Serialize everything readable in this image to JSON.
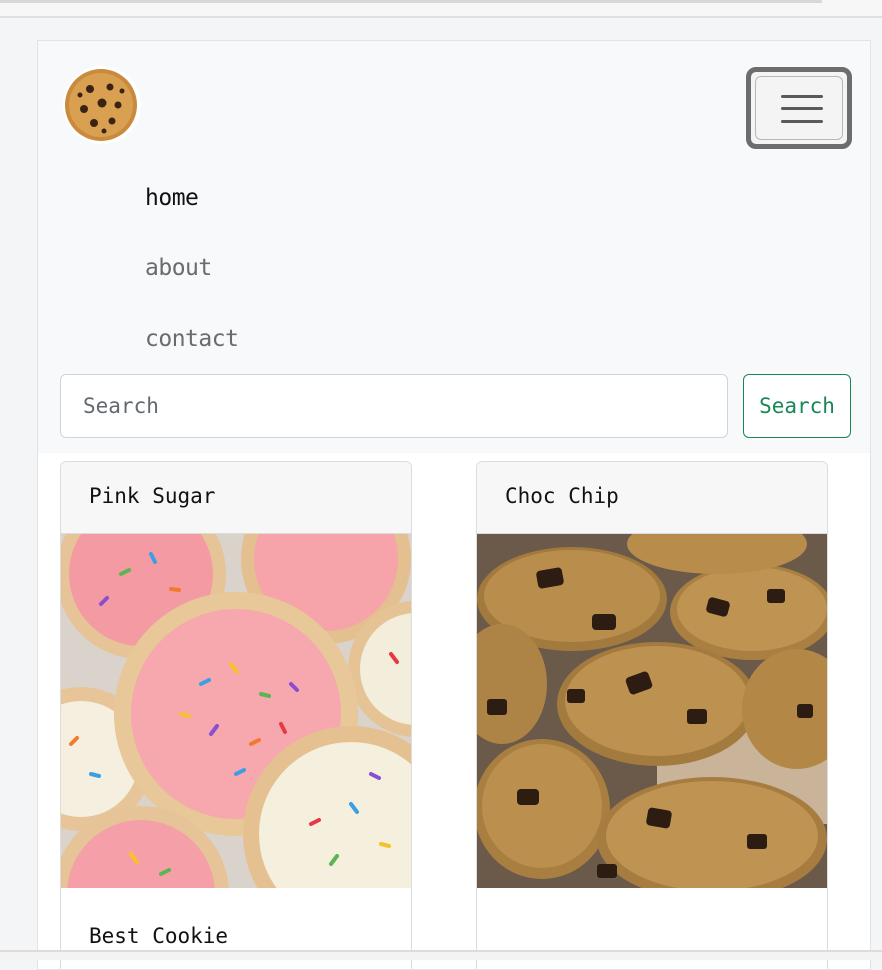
{
  "navbar": {
    "logo_icon": "cookie-logo-icon",
    "toggler_icon": "hamburger-menu-icon",
    "links": [
      {
        "label": "home",
        "state": "active"
      },
      {
        "label": "about",
        "state": "muted"
      },
      {
        "label": "contact",
        "state": "muted"
      }
    ]
  },
  "search": {
    "placeholder": "Search",
    "button_label": "Search"
  },
  "cards": [
    {
      "header": "Pink Sugar",
      "image_icon": "pink-sugar-cookies-image",
      "body_title": "Best Cookie"
    },
    {
      "header": "Choc Chip",
      "image_icon": "chocolate-chip-cookies-image",
      "link": " "
    }
  ],
  "colors": {
    "navbar_bg": "#f8f9fa",
    "search_button": "#198754",
    "link": "#0d6efd"
  }
}
